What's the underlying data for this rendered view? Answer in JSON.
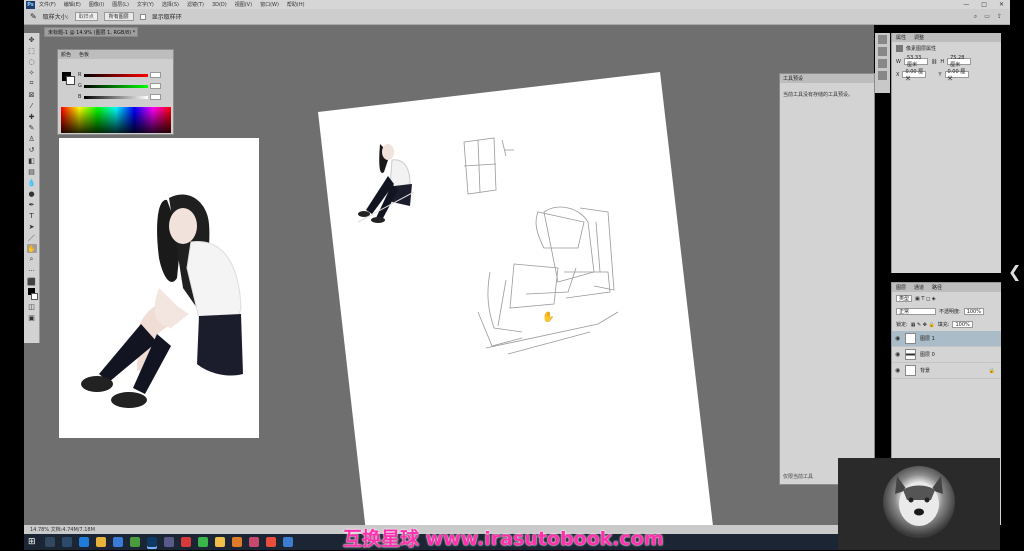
{
  "app": {
    "logo": "Ps",
    "menu": [
      "文件(F)",
      "编辑(E)",
      "图像(I)",
      "图层(L)",
      "文字(Y)",
      "选择(S)",
      "滤镜(T)",
      "3D(D)",
      "视图(V)",
      "窗口(W)",
      "帮助(H)"
    ]
  },
  "options_bar": {
    "sample_size_label": "取样大小:",
    "sample_size_value": "取样点",
    "sample_label": "所有图层",
    "show_ring_label": "显示取样环"
  },
  "document": {
    "tab_label": "未标题-1 @ 14.9% (图层 1, RGB/8) *",
    "status": "14.78%    文档:4.74M/7.18M"
  },
  "color_panel": {
    "tabs": [
      "颜色",
      "色板"
    ],
    "channels": [
      "R",
      "G",
      "B"
    ],
    "accent_colors": [
      "#ff0000",
      "#ffff00",
      "#00ff00",
      "#00ffff",
      "#0000ff",
      "#ff00ff"
    ]
  },
  "text_panel": {
    "title": "工具预设",
    "message": "当前工具没有存储的工具预设。",
    "footer": "仅限当前工具"
  },
  "properties_panel": {
    "tabs": [
      "属性",
      "调整"
    ],
    "section_label": "像素图层属性",
    "w_label": "W",
    "w_value": "53.33 厘米",
    "h_label": "H",
    "h_value": "75.28 厘米",
    "x_label": "X",
    "x_value": "0.00 厘米",
    "y_label": "Y",
    "y_value": "0.00 厘米"
  },
  "layers_panel": {
    "tabs": [
      "图层",
      "通道",
      "路径"
    ],
    "kind_filter": "类型",
    "blend_mode": "正常",
    "opacity_label": "不透明度:",
    "opacity_value": "100%",
    "lock_label": "锁定:",
    "fill_label": "填充:",
    "fill_value": "100%",
    "layers": [
      {
        "name": "图层 1",
        "active": true
      },
      {
        "name": "图层 0",
        "active": false
      },
      {
        "name": "背景",
        "active": false
      }
    ]
  },
  "watermark": "互换星球 www.irasutobook.com",
  "taskbar": {
    "start_icon": "⊞",
    "apps": [
      {
        "name": "search",
        "color": "#33475f"
      },
      {
        "name": "taskview",
        "color": "#2e4a6b"
      },
      {
        "name": "edge",
        "color": "#1e7bd8"
      },
      {
        "name": "explorer",
        "color": "#e8b33b"
      },
      {
        "name": "mail",
        "color": "#3a7bd5"
      },
      {
        "name": "xbox",
        "color": "#4a9a3e"
      },
      {
        "name": "photoshop",
        "color": "#0e3a66"
      },
      {
        "name": "photos",
        "color": "#5a5a8a"
      },
      {
        "name": "netease",
        "color": "#d63a3a"
      },
      {
        "name": "wechat",
        "color": "#3bb54a"
      },
      {
        "name": "folder",
        "color": "#f0c04a"
      },
      {
        "name": "store",
        "color": "#e07b2a"
      },
      {
        "name": "paint",
        "color": "#c7486c"
      },
      {
        "name": "browser",
        "color": "#e94e3c"
      },
      {
        "name": "capture",
        "color": "#3d7dd1"
      }
    ]
  },
  "tools": [
    "move",
    "marquee",
    "lasso",
    "quick-select",
    "crop",
    "frame",
    "eyedropper",
    "healing",
    "brush",
    "stamp",
    "history-brush",
    "eraser",
    "gradient",
    "blur",
    "dodge",
    "pen",
    "text",
    "path-select",
    "shape",
    "hand",
    "zoom",
    "more"
  ]
}
